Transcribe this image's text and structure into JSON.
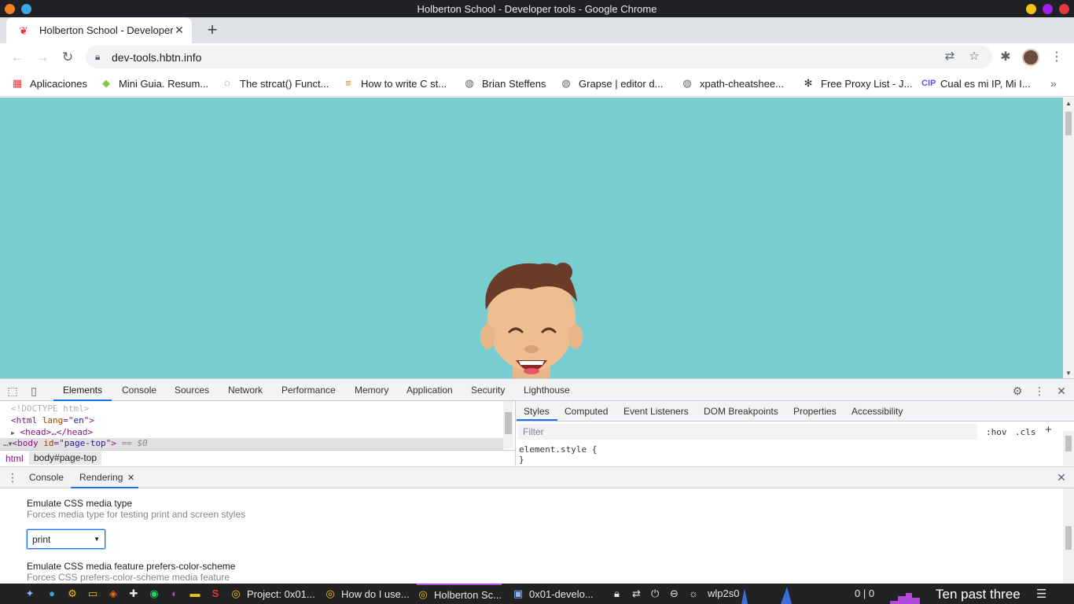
{
  "window": {
    "title": "Holberton School - Developer tools - Google Chrome"
  },
  "tab": {
    "title": "Holberton School - Developer tools",
    "close": "✕"
  },
  "omnibox": {
    "url": "dev-tools.hbtn.info"
  },
  "bookmarks": [
    {
      "label": "Aplicaciones",
      "icon": "apps-grid-icon"
    },
    {
      "label": "Mini Guia. Resum...",
      "icon": "diamond-icon"
    },
    {
      "label": "The strcat() Funct...",
      "icon": "bulb-icon"
    },
    {
      "label": "How to write C st...",
      "icon": "stackoverflow-icon"
    },
    {
      "label": "Brian Steffens",
      "icon": "globe-icon"
    },
    {
      "label": "Grapse | editor d...",
      "icon": "globe-icon"
    },
    {
      "label": "xpath-cheatshee...",
      "icon": "globe-icon"
    },
    {
      "label": "Free Proxy List - J...",
      "icon": "star-burst-icon"
    },
    {
      "label": "Cual es mi IP, Mi I...",
      "icon": "cip-icon"
    }
  ],
  "devtools": {
    "tabs": [
      "Elements",
      "Console",
      "Sources",
      "Network",
      "Performance",
      "Memory",
      "Application",
      "Security",
      "Lighthouse"
    ],
    "active_tab": "Elements",
    "elements": {
      "doctype": "<!DOCTYPE html>",
      "html_open": {
        "tag": "html",
        "attr": "lang",
        "value": "en"
      },
      "head": "<head>…</head>",
      "body": {
        "tag": "body",
        "attr": "id",
        "value": "page-top",
        "suffix": "== $0"
      }
    },
    "breadcrumbs": [
      "html",
      "body#page-top"
    ],
    "styles_tabs": [
      "Styles",
      "Computed",
      "Event Listeners",
      "DOM Breakpoints",
      "Properties",
      "Accessibility"
    ],
    "filter_placeholder": "Filter",
    "hov": ":hov",
    "cls": ".cls",
    "element_style": "element.style {\n}",
    "drawer_tabs": [
      "Console",
      "Rendering"
    ],
    "rendering": {
      "media_type_title": "Emulate CSS media type",
      "media_type_desc": "Forces media type for testing print and screen styles",
      "media_type_value": "print",
      "color_scheme_title": "Emulate CSS media feature prefers-color-scheme",
      "color_scheme_desc": "Forces CSS prefers-color-scheme media feature"
    }
  },
  "taskbar": {
    "tasks": [
      {
        "label": "Project: 0x01...",
        "icon": "chrome-icon"
      },
      {
        "label": "How do I use...",
        "icon": "chrome-icon"
      },
      {
        "label": "Holberton Sc...",
        "icon": "chrome-icon"
      },
      {
        "label": "0x01-develo...",
        "icon": "terminal-icon"
      }
    ],
    "network": "wlp2s0",
    "counter": "0 | 0",
    "clock": "Ten past three"
  },
  "colors": {
    "page_bg": "#78cdd1",
    "accent": "#1a73e8",
    "taskbar_active": "#b048d8"
  }
}
